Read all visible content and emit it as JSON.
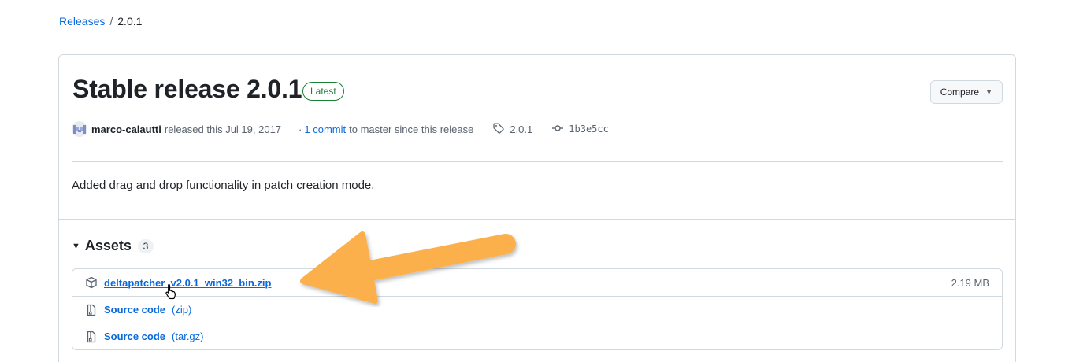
{
  "breadcrumb": {
    "releases": "Releases",
    "separator": "/",
    "current": "2.0.1"
  },
  "release": {
    "title": "Stable release 2.0.1",
    "badge": "Latest",
    "compare_label": "Compare",
    "author": "marco-calautti",
    "released_text": "released this Jul 19, 2017",
    "dot": "·",
    "commits_link": "1 commit",
    "commits_suffix": "to master since this release",
    "tag": "2.0.1",
    "commit_hash": "1b3e5cc",
    "notes": "Added drag and drop functionality in patch creation mode."
  },
  "assets": {
    "title": "Assets",
    "count": "3",
    "items": [
      {
        "name": "deltapatcher_v2.0.1_win32_bin.zip",
        "format": "",
        "size": "2.19 MB",
        "icon": "package-icon"
      },
      {
        "name": "Source code",
        "format": "(zip)",
        "size": "",
        "icon": "file-zip-icon"
      },
      {
        "name": "Source code",
        "format": "(tar.gz)",
        "size": "",
        "icon": "file-zip-icon"
      }
    ]
  },
  "colors": {
    "link": "#0969da",
    "latest": "#1a7f37",
    "annotation_arrow": "#fbb04b"
  }
}
